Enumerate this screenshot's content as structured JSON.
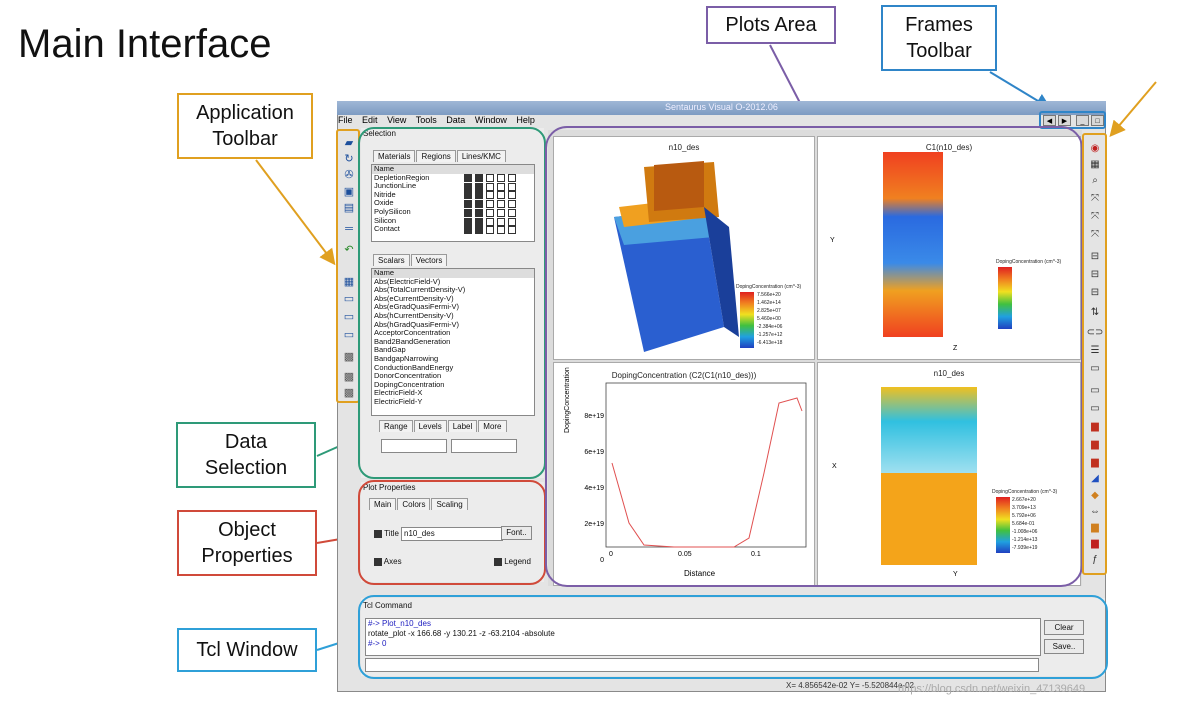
{
  "slide_title": "Main Interface",
  "callouts": {
    "plots_area": "Plots Area",
    "frames_toolbar_line1": "Frames",
    "frames_toolbar_line2": "Toolbar",
    "app_toolbar_line1": "Application",
    "app_toolbar_line2": "Toolbar",
    "data_sel_line1": "Data",
    "data_sel_line2": "Selection",
    "obj_prop_line1": "Object",
    "obj_prop_line2": "Properties",
    "tcl_window": "Tcl Window"
  },
  "colors": {
    "plots_area": "#7b5ea7",
    "frames_toolbar": "#2f85c8",
    "app_toolbar": "#e0a020",
    "data_selection": "#2e9a78",
    "object_properties": "#d04a3a",
    "tcl_window": "#2fa0d8"
  },
  "window": {
    "title": "Sentaurus Visual O-2012.06"
  },
  "menu": [
    "File",
    "Edit",
    "View",
    "Tools",
    "Data",
    "Window",
    "Help"
  ],
  "selection": {
    "header": "Selection",
    "tabs": [
      "Materials",
      "Regions",
      "Lines/KMC"
    ],
    "materials_col": "Name",
    "materials": [
      "DepletionRegion",
      "JunctionLine",
      "Nitride",
      "Oxide",
      "PolySilicon",
      "Silicon",
      "Contact"
    ],
    "scalar_tabs": [
      "Scalars",
      "Vectors"
    ],
    "scalars_col": "Name",
    "scalars": [
      "Abs(ElectricField-V)",
      "Abs(TotalCurrentDensity-V)",
      "Abs(eCurrentDensity-V)",
      "Abs(eGradQuasiFermi-V)",
      "Abs(hCurrentDensity-V)",
      "Abs(hGradQuasiFermi-V)",
      "AcceptorConcentration",
      "Band2BandGeneration",
      "BandGap",
      "BandgapNarrowing",
      "ConductionBandEnergy",
      "DonorConcentration",
      "DopingConcentration",
      "ElectricField-X",
      "ElectricField-Y"
    ],
    "bottom_tabs": [
      "Range",
      "Levels",
      "Label",
      "More"
    ]
  },
  "plot_properties": {
    "header": "Plot Properties",
    "tabs": [
      "Main",
      "Colors",
      "Scaling"
    ],
    "title_label": "Title",
    "title_value": "n10_des",
    "font_button": "Font..",
    "axes_label": "Axes",
    "legend_label": "Legend"
  },
  "plots": {
    "p1_title": "n10_des",
    "p1_legend": "DopingConcentration (cm^-3)",
    "p1_legend_vals": [
      "7.566e+20",
      "1.462e+14",
      "2.825e+07",
      "5.460e+00",
      "-2.384e+06",
      "-1.257e+12",
      "-6.413e+18"
    ],
    "p2_title": "C1(n10_des)",
    "p2_xaxis": "Z",
    "p2_yaxis": "Y",
    "p2_legend": "DopingConcentration (cm^-3)",
    "p3_title": "DopingConcentration (C2(C1(n10_des)))",
    "p3_xlabel": "Distance",
    "p3_ylabel": "DopingConcentration",
    "p3_yticks": [
      "8e+19",
      "6e+19",
      "4e+19",
      "2e+19",
      "0"
    ],
    "p3_xticks": [
      "0",
      "0.05",
      "0.1"
    ],
    "p4_title": "n10_des",
    "p4_xaxis": "Y",
    "p4_yaxis": "X",
    "p4_legend": "DopingConcentration (cm^-3)",
    "p4_legend_vals": [
      "2.667e+20",
      "3.709e+13",
      "5.792e+06",
      "5.684e-01",
      "-1.008e+06",
      "-1.214e+13",
      "-7.939e+19"
    ]
  },
  "tcl": {
    "header": "Tcl Command",
    "lines": [
      "#-> Plot_n10_des",
      "rotate_plot -x 166.68 -y 130.21 -z -63.2104 -absolute",
      "#-> 0"
    ],
    "clear_button": "Clear",
    "save_button": "Save.."
  },
  "status": {
    "coords": "X= 4.856542e-02   Y= -5.520844e-02",
    "watermark": "https://blog.csdn.net/weixin_47139649"
  }
}
